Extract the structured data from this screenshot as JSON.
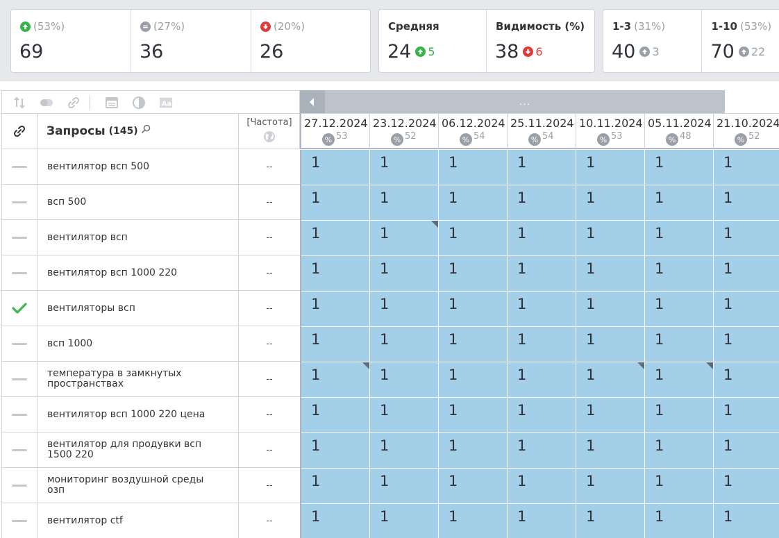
{
  "summary": {
    "group1": [
      {
        "pct": "(53%)",
        "value": "69",
        "icon": "arrow-up-circle-icon",
        "color": "#38b24a"
      },
      {
        "pct": "(27%)",
        "value": "36",
        "icon": "minus-circle-icon",
        "color": "#9aa0a6"
      },
      {
        "pct": "(20%)",
        "value": "26",
        "icon": "arrow-down-circle-icon",
        "color": "#e03a3a"
      }
    ],
    "group2": [
      {
        "label": "Средняя",
        "value": "24",
        "delta": "5",
        "direction": "up"
      },
      {
        "label": "Видимость (%)",
        "value": "38",
        "delta": "6",
        "direction": "down"
      }
    ],
    "group3": [
      {
        "label": "1-3",
        "pct": "(31%)",
        "value": "40",
        "delta": "3"
      },
      {
        "label": "1-10",
        "pct": "(53%)",
        "value": "70",
        "delta": "22"
      }
    ]
  },
  "toolbar": {
    "icons": [
      "sort-icon",
      "toggle-icon",
      "link-icon",
      "window-icon",
      "contrast-icon",
      "font-icon"
    ]
  },
  "table": {
    "header": {
      "link_icon": "link-icon",
      "queries_title": "Запросы",
      "queries_count": "(145)",
      "frequency_title": "[Частота]",
      "frequency_icon": "globe-icon"
    },
    "rows": [
      {
        "query": "вентилятор всп 500",
        "freq": "--",
        "status": "dash"
      },
      {
        "query": "всп 500",
        "freq": "--",
        "status": "dash"
      },
      {
        "query": "вентилятор всп",
        "freq": "--",
        "status": "dash"
      },
      {
        "query": "вентилятор всп 1000 220",
        "freq": "--",
        "status": "dash"
      },
      {
        "query": "вентиляторы всп",
        "freq": "--",
        "status": "check"
      },
      {
        "query": "всп 1000",
        "freq": "--",
        "status": "dash"
      },
      {
        "query": "температура в замкнутых пространствах",
        "freq": "--",
        "status": "dash"
      },
      {
        "query": "вентилятор всп 1000 220 цена",
        "freq": "--",
        "status": "dash"
      },
      {
        "query": "вентилятор для продувки всп 1500 220",
        "freq": "--",
        "status": "dash"
      },
      {
        "query": "мониторинг воздушной среды озп",
        "freq": "--",
        "status": "dash"
      },
      {
        "query": "вентилятор ctf",
        "freq": "--",
        "status": "dash"
      }
    ]
  },
  "scroller": {
    "thumb_label": "..."
  },
  "grid": {
    "columns": [
      {
        "date": "27.12.2024",
        "pct_symbol": "%",
        "pct": "53"
      },
      {
        "date": "23.12.2024",
        "pct_symbol": "%",
        "pct": "52"
      },
      {
        "date": "06.12.2024",
        "pct_symbol": "%",
        "pct": "54"
      },
      {
        "date": "25.11.2024",
        "pct_symbol": "%",
        "pct": "54"
      },
      {
        "date": "10.11.2024",
        "pct_symbol": "%",
        "pct": "53"
      },
      {
        "date": "05.11.2024",
        "pct_symbol": "%",
        "pct": "48"
      },
      {
        "date": "21.10.2024",
        "pct_symbol": "%",
        "pct": "52"
      }
    ],
    "cell_color": "#a3cfe9",
    "values": [
      [
        "1",
        "1",
        "1",
        "1",
        "1",
        "1",
        "1"
      ],
      [
        "1",
        "1",
        "1",
        "1",
        "1",
        "1",
        "1"
      ],
      [
        "1",
        "1",
        "1",
        "1",
        "1",
        "1",
        "1"
      ],
      [
        "1",
        "1",
        "1",
        "1",
        "1",
        "1",
        "1"
      ],
      [
        "1",
        "1",
        "1",
        "1",
        "1",
        "1",
        "1"
      ],
      [
        "1",
        "1",
        "1",
        "1",
        "1",
        "1",
        "1"
      ],
      [
        "1",
        "1",
        "1",
        "1",
        "1",
        "1",
        "1"
      ],
      [
        "1",
        "1",
        "1",
        "1",
        "1",
        "1",
        "1"
      ],
      [
        "1",
        "1",
        "1",
        "1",
        "1",
        "1",
        "1"
      ],
      [
        "1",
        "1",
        "1",
        "1",
        "1",
        "1",
        "1"
      ],
      [
        "1",
        "1",
        "1",
        "1",
        "1",
        "1",
        "1"
      ]
    ],
    "corner_marks": [
      [
        2,
        1
      ],
      [
        6,
        0
      ],
      [
        6,
        4
      ],
      [
        6,
        5
      ]
    ]
  }
}
